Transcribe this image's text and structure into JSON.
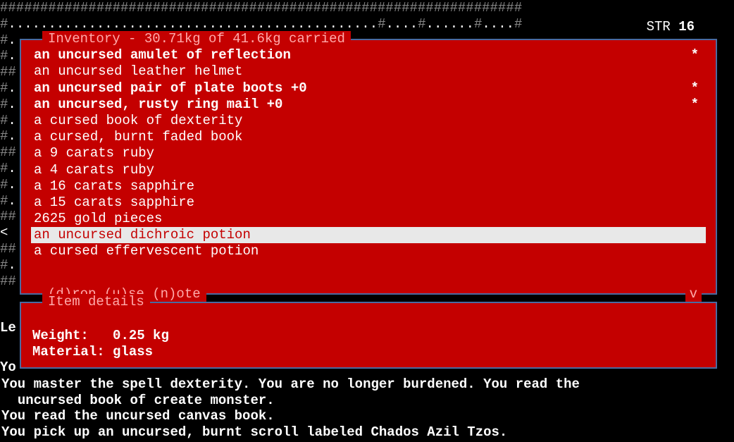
{
  "stats": {
    "str_label": "STR",
    "str_value": "16"
  },
  "map": {
    "rows": [
      "#################################################################",
      "#..............................................#....#......#....#",
      "#.",
      "#.",
      "##",
      "#.",
      "#.",
      "#.",
      "#.",
      "##",
      "#.",
      "#.",
      "#.                                                                              .",
      "##",
      "< ",
      "##",
      "#.",
      "##"
    ]
  },
  "inventory": {
    "title": "Inventory - 30.71kg of 41.6kg carried",
    "footer": "(d)rop (u)se (n)ote",
    "scroll_indicator": "v",
    "items": [
      {
        "text": "an uncursed amulet of reflection",
        "bold": true,
        "mark": "*",
        "selected": false
      },
      {
        "text": "an uncursed leather helmet",
        "bold": false,
        "mark": "",
        "selected": false
      },
      {
        "text": "an uncursed pair of plate boots +0",
        "bold": true,
        "mark": "*",
        "selected": false
      },
      {
        "text": "an uncursed, rusty ring mail +0",
        "bold": true,
        "mark": "*",
        "selected": false
      },
      {
        "text": "a cursed book of dexterity",
        "bold": false,
        "mark": "",
        "selected": false
      },
      {
        "text": "a cursed, burnt faded book",
        "bold": false,
        "mark": "",
        "selected": false
      },
      {
        "text": "a 9 carats ruby",
        "bold": false,
        "mark": "",
        "selected": false
      },
      {
        "text": "a 4 carats ruby",
        "bold": false,
        "mark": "",
        "selected": false
      },
      {
        "text": "a 16 carats sapphire",
        "bold": false,
        "mark": "",
        "selected": false
      },
      {
        "text": "a 15 carats sapphire",
        "bold": false,
        "mark": "",
        "selected": false
      },
      {
        "text": "2625 gold pieces",
        "bold": false,
        "mark": "",
        "selected": false
      },
      {
        "text": "an uncursed dichroic potion",
        "bold": false,
        "mark": "",
        "selected": true
      },
      {
        "text": "a cursed effervescent potion",
        "bold": false,
        "mark": "",
        "selected": false
      }
    ]
  },
  "item_details": {
    "title": "Item details",
    "weight_label": "Weight:",
    "weight_value": "0.25 kg",
    "material_label": "Material:",
    "material_value": "glass"
  },
  "peek": {
    "level_fragment": "Le",
    "msg_fragment": "Yo"
  },
  "messages": [
    "You master the spell dexterity. You are no longer burdened. You read the",
    "  uncursed book of create monster.",
    "You read the uncursed canvas book.",
    "You pick up an uncursed, burnt scroll labeled Chados Azil Tzos."
  ]
}
